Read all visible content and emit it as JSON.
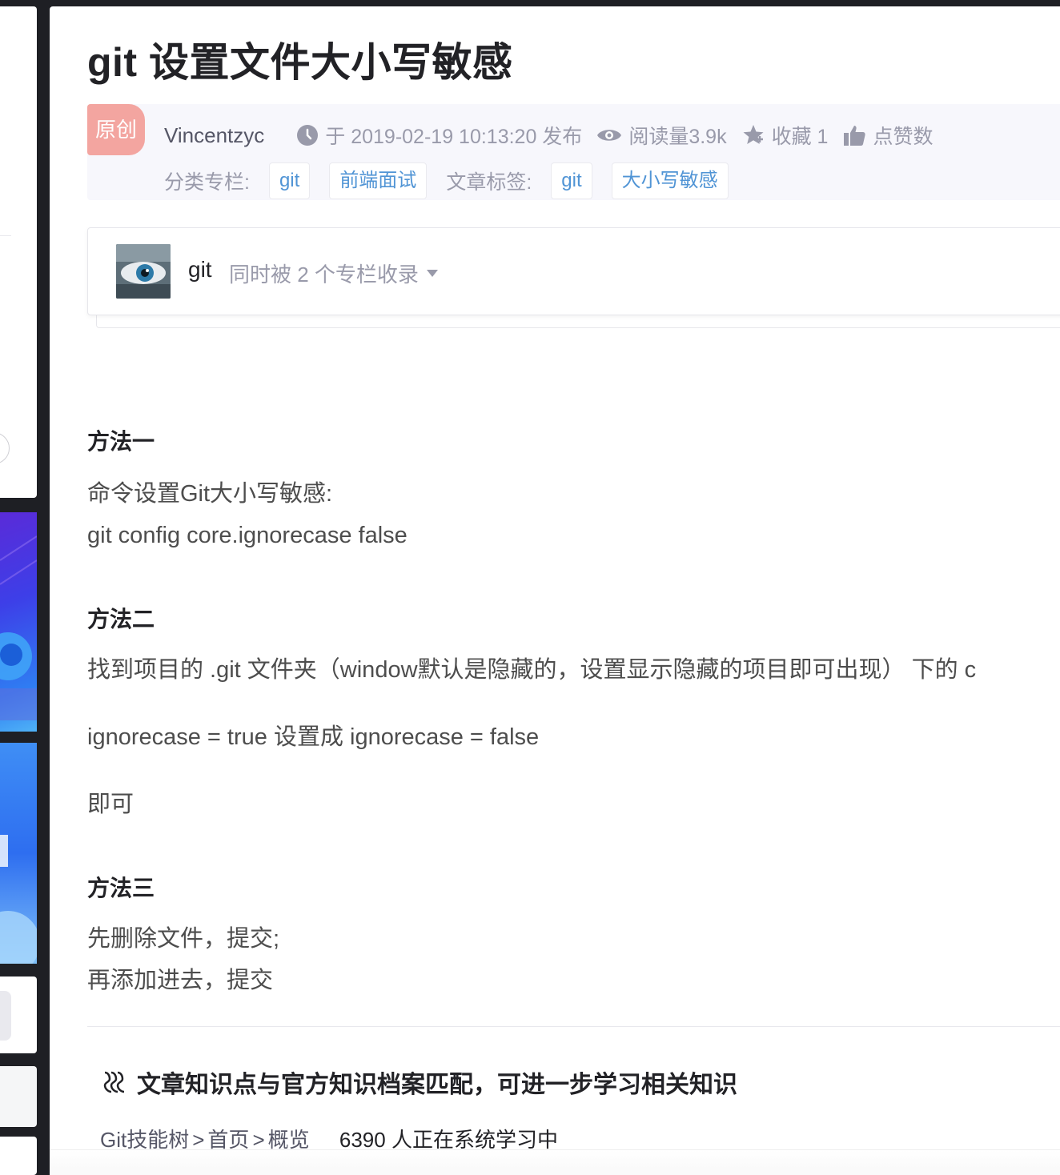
{
  "article": {
    "title": "git 设置文件大小写敏感",
    "original_badge": "原创",
    "author": "Vincentzyc",
    "publish_time": "于 2019-02-19 10:13:20 发布",
    "views": "阅读量3.9k",
    "favorites": "收藏 1",
    "likes": "点赞数",
    "category_label": "分类专栏:",
    "categories": [
      "git",
      "前端面试"
    ],
    "tags_label": "文章标签:",
    "tags": [
      "git",
      "大小写敏感"
    ]
  },
  "column": {
    "name": "git",
    "description": "同时被 2 个专栏收录"
  },
  "content": {
    "method1_heading": "方法一",
    "method1_line1": "命令设置Git大小写敏感:",
    "method1_line2": "git config core.ignorecase false",
    "method2_heading": "方法二",
    "method2_line1": "找到项目的 .git 文件夹（window默认是隐藏的，设置显示隐藏的项目即可出现） 下的 c",
    "method2_line2": "ignorecase = true 设置成 ignorecase = false",
    "method2_line3": "即可",
    "method3_heading": "方法三",
    "method3_line1": "先删除文件，提交;",
    "method3_line2": "再添加进去，提交"
  },
  "knowledge": {
    "title": "文章知识点与官方知识档案匹配，可进一步学习相关知识",
    "path": [
      "Git技能树",
      "首页",
      "概览"
    ],
    "separator": ">",
    "learners": "6390 人正在系统学习中"
  },
  "colors": {
    "badge": "#f3a5a0",
    "tag_text": "#5094d5",
    "meta_text": "#999aaa",
    "meta_bg": "#f7f7fc"
  },
  "icons": [
    "clock-icon",
    "eye-icon",
    "star-icon",
    "thumbs-up-icon",
    "caret-down-icon",
    "knowledge-icon"
  ]
}
